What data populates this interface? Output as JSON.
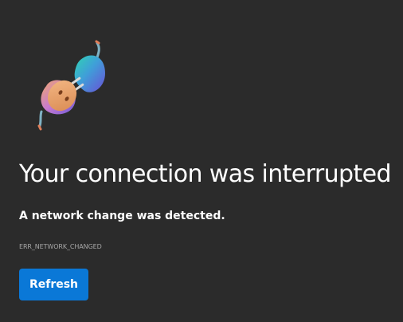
{
  "page": {
    "title": "Your connection was interrupted",
    "subtitle": "A network change was detected.",
    "error_code": "ERR_NETWORK_CHANGED"
  },
  "actions": {
    "refresh_label": "Refresh"
  },
  "illustration": {
    "icon": "unplugged-plug-icon"
  },
  "colors": {
    "background": "#2b2b2b",
    "text": "#ffffff",
    "error_code_text": "#a6a6a6",
    "button": "#0a78d7"
  }
}
